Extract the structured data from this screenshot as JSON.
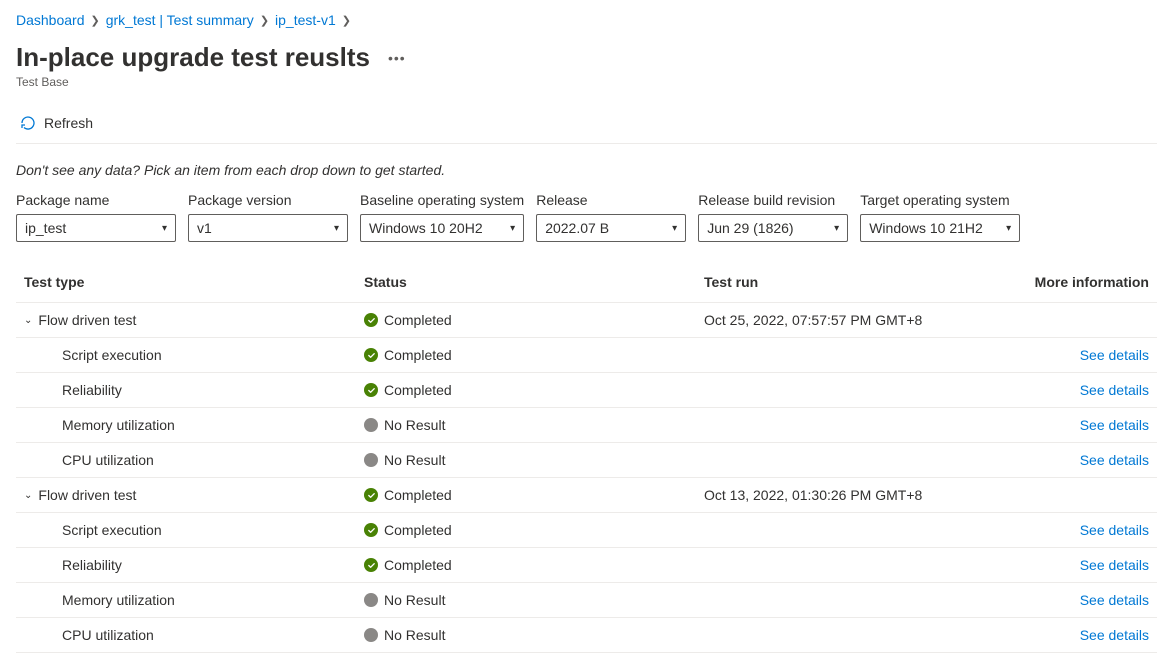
{
  "breadcrumb": {
    "items": [
      "Dashboard",
      "grk_test | Test summary",
      "ip_test-v1"
    ]
  },
  "header": {
    "title": "In-place upgrade test reuslts",
    "subtitle": "Test Base"
  },
  "toolbar": {
    "refresh_label": "Refresh"
  },
  "hint": "Don't see any data? Pick an item from each drop down to get started.",
  "filters": {
    "package_name": {
      "label": "Package name",
      "value": "ip_test"
    },
    "package_version": {
      "label": "Package version",
      "value": "v1"
    },
    "baseline_os": {
      "label": "Baseline operating system",
      "value": "Windows 10 20H2"
    },
    "release": {
      "label": "Release",
      "value": "2022.07 B"
    },
    "release_build": {
      "label": "Release build revision",
      "value": "Jun 29 (1826)"
    },
    "target_os": {
      "label": "Target operating system",
      "value": "Windows 10 21H2"
    }
  },
  "table": {
    "headers": {
      "test_type": "Test type",
      "status": "Status",
      "test_run": "Test run",
      "more_info": "More information"
    },
    "status_labels": {
      "completed": "Completed",
      "no_result": "No Result"
    },
    "see_details_label": "See details",
    "groups": [
      {
        "name": "Flow driven test",
        "status": "completed",
        "test_run": "Oct 25, 2022, 07:57:57 PM GMT+8",
        "rows": [
          {
            "name": "Script execution",
            "status": "completed"
          },
          {
            "name": "Reliability",
            "status": "completed"
          },
          {
            "name": "Memory utilization",
            "status": "no_result"
          },
          {
            "name": "CPU utilization",
            "status": "no_result"
          }
        ]
      },
      {
        "name": "Flow driven test",
        "status": "completed",
        "test_run": "Oct 13, 2022, 01:30:26 PM GMT+8",
        "rows": [
          {
            "name": "Script execution",
            "status": "completed"
          },
          {
            "name": "Reliability",
            "status": "completed"
          },
          {
            "name": "Memory utilization",
            "status": "no_result"
          },
          {
            "name": "CPU utilization",
            "status": "no_result"
          }
        ]
      }
    ]
  }
}
